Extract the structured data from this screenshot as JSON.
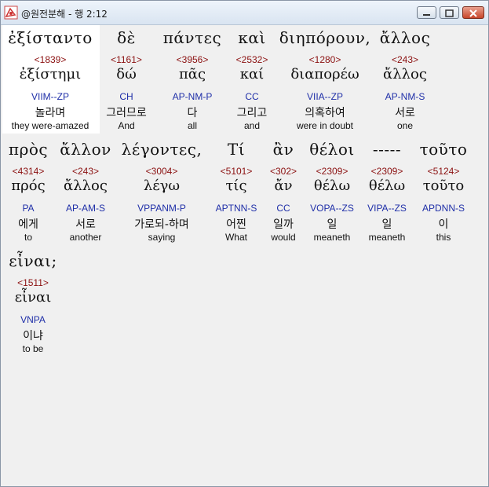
{
  "window": {
    "title": "@원전분해 - 행 2:12"
  },
  "colors": {
    "strong": "#8b1010",
    "parse": "#1f2fa8",
    "titlebar": "#d9e4f1"
  },
  "rows": [
    {
      "words": [
        {
          "greek": "ἐξίσταντο",
          "strong": "<1839>",
          "lemma": "ἐξίστημι",
          "parse": "VIIM--ZP",
          "korean": "놀라며",
          "english": "they were-amazed"
        },
        {
          "greek": "δὲ",
          "strong": "<1161>",
          "lemma": "δώ",
          "parse": "CH",
          "korean": "그러므로",
          "english": "And"
        },
        {
          "greek": "πάντες",
          "strong": "<3956>",
          "lemma": "πᾶς",
          "parse": "AP-NM-P",
          "korean": "다",
          "english": "all"
        },
        {
          "greek": "καὶ",
          "strong": "<2532>",
          "lemma": "καί",
          "parse": "CC",
          "korean": "그리고",
          "english": "and"
        },
        {
          "greek": "διηπόρουν,",
          "strong": "<1280>",
          "lemma": "διαπορέω",
          "parse": "VIIA--ZP",
          "korean": "의혹하여",
          "english": "were in doubt"
        },
        {
          "greek": "ἄλλος",
          "strong": "<243>",
          "lemma": "ἄλλος",
          "parse": "AP-NM-S",
          "korean": "서로",
          "english": "one"
        }
      ]
    },
    {
      "words": [
        {
          "greek": "πρὸς",
          "strong": "<4314>",
          "lemma": "πρός",
          "parse": "PA",
          "korean": "에게",
          "english": "to"
        },
        {
          "greek": "ἄλλον",
          "strong": "<243>",
          "lemma": "ἄλλος",
          "parse": "AP-AM-S",
          "korean": "서로",
          "english": "another"
        },
        {
          "greek": "λέγοντες,",
          "strong": "<3004>",
          "lemma": "λέγω",
          "parse": "VPPANM-P",
          "korean": "가로되-하며",
          "english": "saying"
        },
        {
          "greek": "Τί",
          "strong": "<5101>",
          "lemma": "τίς",
          "parse": "APTNN-S",
          "korean": "어찐",
          "english": "What"
        },
        {
          "greek": "ἂν",
          "strong": "<302>",
          "lemma": "ἄν",
          "parse": "CC",
          "korean": "일까",
          "english": "would"
        },
        {
          "greek": "θέλοι",
          "strong": "<2309>",
          "lemma": "θέλω",
          "parse": "VOPA--ZS",
          "korean": "일",
          "english": "meaneth"
        },
        {
          "greek": "-----",
          "strong": "<2309>",
          "lemma": "θέλω",
          "parse": "VIPA--ZS",
          "korean": "일",
          "english": "meaneth"
        },
        {
          "greek": "τοῦτο",
          "strong": "<5124>",
          "lemma": "τοῦτο",
          "parse": "APDNN-S",
          "korean": "이",
          "english": "this"
        }
      ]
    },
    {
      "words": [
        {
          "greek": "εἶναι;",
          "strong": "<1511>",
          "lemma": "εἶναι",
          "parse": "VNPA",
          "korean": "이냐",
          "english": "to be"
        }
      ]
    }
  ]
}
